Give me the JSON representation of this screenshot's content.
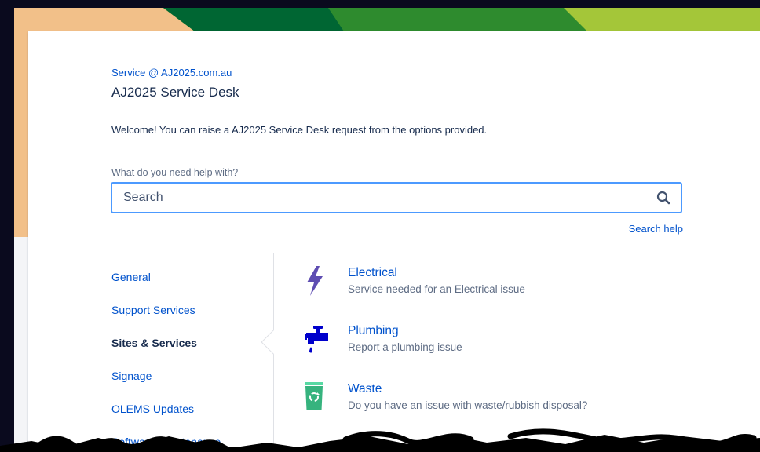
{
  "portal": {
    "breadcrumb_link": "Service @ AJ2025.com.au",
    "title": "AJ2025 Service Desk",
    "welcome": "Welcome! You can raise a AJ2025 Service Desk request from the options provided."
  },
  "search": {
    "label": "What do you need help with?",
    "placeholder": "Search",
    "help_link": "Search help"
  },
  "groups": [
    {
      "label": "General",
      "active": false
    },
    {
      "label": "Support Services",
      "active": false
    },
    {
      "label": "Sites & Services",
      "active": true
    },
    {
      "label": "Signage",
      "active": false
    },
    {
      "label": "OLEMS Updates",
      "active": false
    },
    {
      "label": "Software Maintenance",
      "active": false
    }
  ],
  "requests": [
    {
      "name": "Electrical",
      "description": "Service needed for an Electrical issue",
      "icon": "lightning-bolt-icon",
      "color": "#5e4db2"
    },
    {
      "name": "Plumbing",
      "description": "Report a plumbing issue",
      "icon": "water-tap-icon",
      "color": "#0000cc"
    },
    {
      "name": "Waste",
      "description": "Do you have an issue with waste/rubbish disposal?",
      "icon": "recycle-bin-icon",
      "color": "#36b37e"
    }
  ],
  "colors": {
    "link": "#0052cc",
    "text": "#172b4d",
    "subtle_text": "#5e6c84",
    "focus_border": "#4c9aff",
    "banner_peach": "#f2c089",
    "banner_dark_green": "#006633",
    "banner_green": "#2e8b2e",
    "banner_lime": "#a4c639"
  }
}
